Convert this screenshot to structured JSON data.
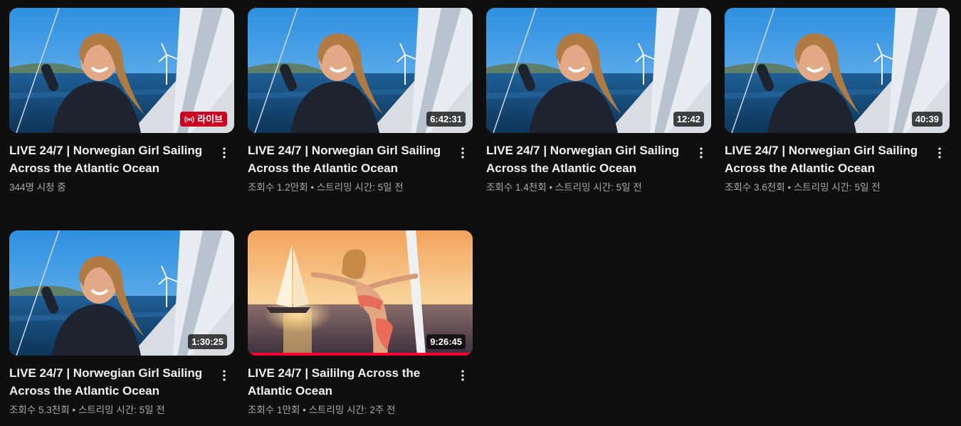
{
  "videos": [
    {
      "title": "LIVE 24/7 | Norwegian Girl Sailing Across the Atlantic Ocean",
      "badge": "라이브",
      "badge_type": "live",
      "meta": "344명 시청 중",
      "thumbnail": "girl-on-sailboat-blue-sky"
    },
    {
      "title": "LIVE 24/7 | Norwegian Girl Sailing Across the Atlantic Ocean",
      "badge": "6:42:31",
      "badge_type": "duration",
      "meta": "조회수 1.2만회 • 스트리밍 시간: 5일 전",
      "thumbnail": "girl-on-sailboat-blue-sky"
    },
    {
      "title": "LIVE 24/7 | Norwegian Girl Sailing Across the Atlantic Ocean",
      "badge": "12:42",
      "badge_type": "duration",
      "meta": "조회수 1.4천회 • 스트리밍 시간: 5일 전",
      "thumbnail": "girl-on-sailboat-blue-sky"
    },
    {
      "title": "LIVE 24/7 | Norwegian Girl Sailing Across the Atlantic Ocean",
      "badge": "40:39",
      "badge_type": "duration",
      "meta": "조회수 3.6천회 • 스트리밍 시간: 5일 전",
      "thumbnail": "girl-on-sailboat-blue-sky"
    },
    {
      "title": "LIVE 24/7 | Norwegian Girl Sailing Across the Atlantic Ocean",
      "badge": "1:30:25",
      "badge_type": "duration",
      "meta": "조회수 5.3천회 • 스트리밍 시간: 5일 전",
      "thumbnail": "girl-on-sailboat-blue-sky"
    },
    {
      "title": "LIVE 24/7 | Saililng Across the Atlantic Ocean",
      "badge": "9:26:45",
      "badge_type": "duration",
      "meta": "조회수 1만회 • 스트리밍 시간: 2주 전",
      "thumbnail": "girl-on-sailboat-sunset",
      "watch_progress": 1.0
    }
  ],
  "colors": {
    "background": "#0f0f0f",
    "live_badge": "#cc0020",
    "progress": "#ff0033",
    "meta_text": "#aaaaaa"
  }
}
